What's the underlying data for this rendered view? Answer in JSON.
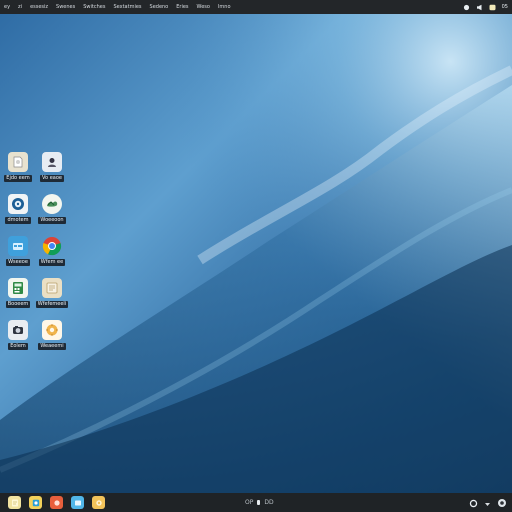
{
  "menubar": {
    "items": [
      "ey",
      "zi",
      "essesiz",
      "Swenes",
      "Switches",
      "Sextatmies",
      "Sedeno",
      "Eries",
      "Weso",
      "Imno"
    ],
    "tray_clock": "05"
  },
  "desktop": {
    "icons": [
      {
        "label": "Ejdo eem",
        "icon": "file-icon",
        "color": "#e8e2cf"
      },
      {
        "label": "Vo eaoe",
        "icon": "contacts-icon",
        "color": "#e6ecf3"
      },
      {
        "label": "dmotem",
        "icon": "disk-icon",
        "color": "#f1f4f6"
      },
      {
        "label": "Woeeoon",
        "icon": "cloud-icon",
        "color": "#f3f6ef"
      },
      {
        "label": "Wseeoe",
        "icon": "folder-icon",
        "color": "#3fa0dc"
      },
      {
        "label": "Wfem ee",
        "icon": "chrome-icon",
        "color": "#ffffff"
      },
      {
        "label": "Booeem",
        "icon": "calculator-icon",
        "color": "#f1f6ef"
      },
      {
        "label": "Wfefemeeli",
        "icon": "notes-icon",
        "color": "#eadfc4"
      },
      {
        "label": "Eolem",
        "icon": "camera-icon",
        "color": "#e9edf1"
      },
      {
        "label": "Weaeemi",
        "icon": "settings-icon",
        "color": "#fff7e8"
      }
    ]
  },
  "taskbar": {
    "apps": [
      {
        "icon": "notes-icon",
        "color": "#f1e3a0"
      },
      {
        "icon": "photos-icon",
        "color": "#f3d15a"
      },
      {
        "icon": "image-icon",
        "color": "#e85f3c"
      },
      {
        "icon": "files-icon",
        "color": "#51b6e8"
      },
      {
        "icon": "settings-icon",
        "color": "#f2c35a"
      }
    ],
    "center_text_left": "OP",
    "center_text_right": "DD",
    "right_items": [
      "clock-icon",
      "dropdown-icon",
      "network-icon"
    ]
  }
}
